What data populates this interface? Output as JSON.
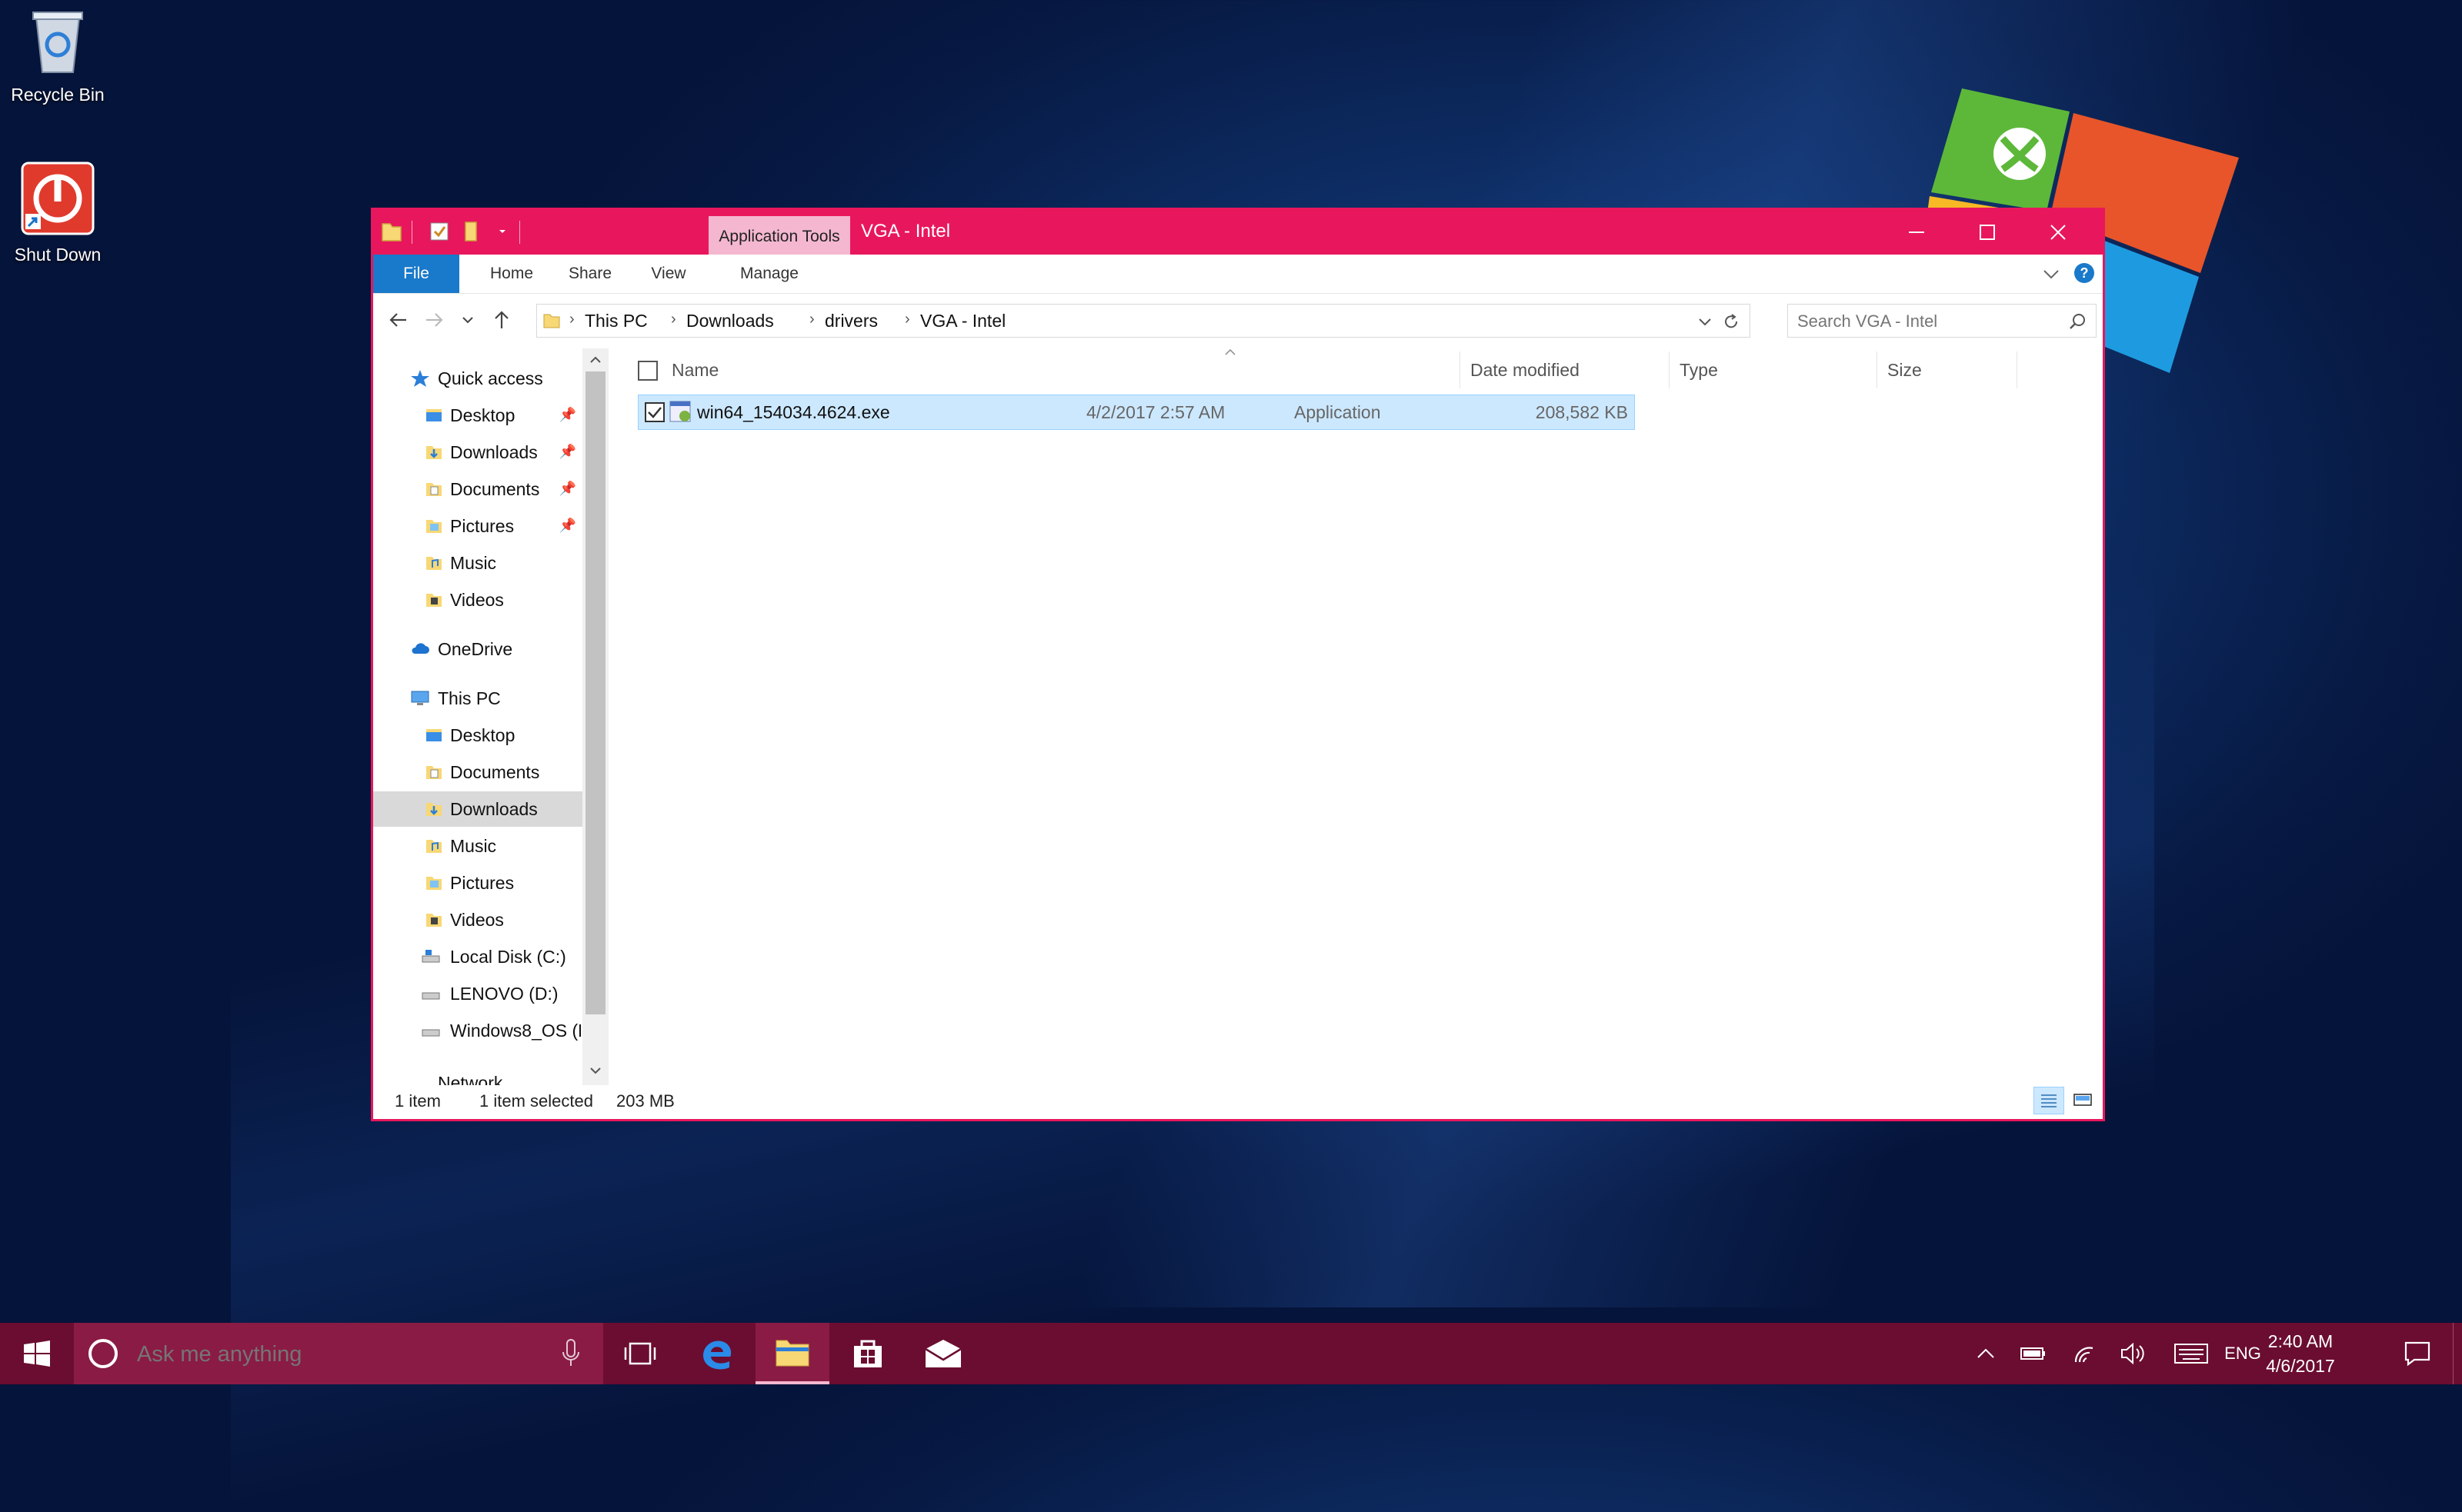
{
  "desktop": {
    "icons": [
      {
        "label": "Recycle Bin",
        "icon": "recycle-bin-icon"
      },
      {
        "label": "Shut Down",
        "icon": "power-icon"
      }
    ]
  },
  "window": {
    "context_tab": "Application Tools",
    "title": "VGA - Intel",
    "accent": "#e8175d",
    "ribbon_tabs": [
      "File",
      "Home",
      "Share",
      "View",
      "Manage"
    ],
    "breadcrumb": [
      "This PC",
      "Downloads",
      "drivers",
      "VGA - Intel"
    ],
    "search_placeholder": "Search VGA - Intel",
    "nav": {
      "quick_access": "Quick access",
      "quick_items": [
        "Desktop",
        "Downloads",
        "Documents",
        "Pictures",
        "Music",
        "Videos"
      ],
      "onedrive": "OneDrive",
      "this_pc": "This PC",
      "pc_items": [
        "Desktop",
        "Documents",
        "Downloads",
        "Music",
        "Pictures",
        "Videos",
        "Local Disk (C:)",
        "LENOVO (D:)",
        "Windows8_OS (E"
      ],
      "network": "Network"
    },
    "columns": [
      "Name",
      "Date modified",
      "Type",
      "Size"
    ],
    "files": [
      {
        "name": "win64_154034.4624.exe",
        "date": "4/2/2017 2:57 AM",
        "type": "Application",
        "size": "208,582 KB"
      }
    ],
    "status": {
      "count": "1 item",
      "selected": "1 item selected",
      "size": "203 MB"
    }
  },
  "taskbar": {
    "search_placeholder": "Ask me anything",
    "language": "ENG",
    "time": "2:40 AM",
    "date": "4/6/2017",
    "color": "#6b0d30"
  }
}
